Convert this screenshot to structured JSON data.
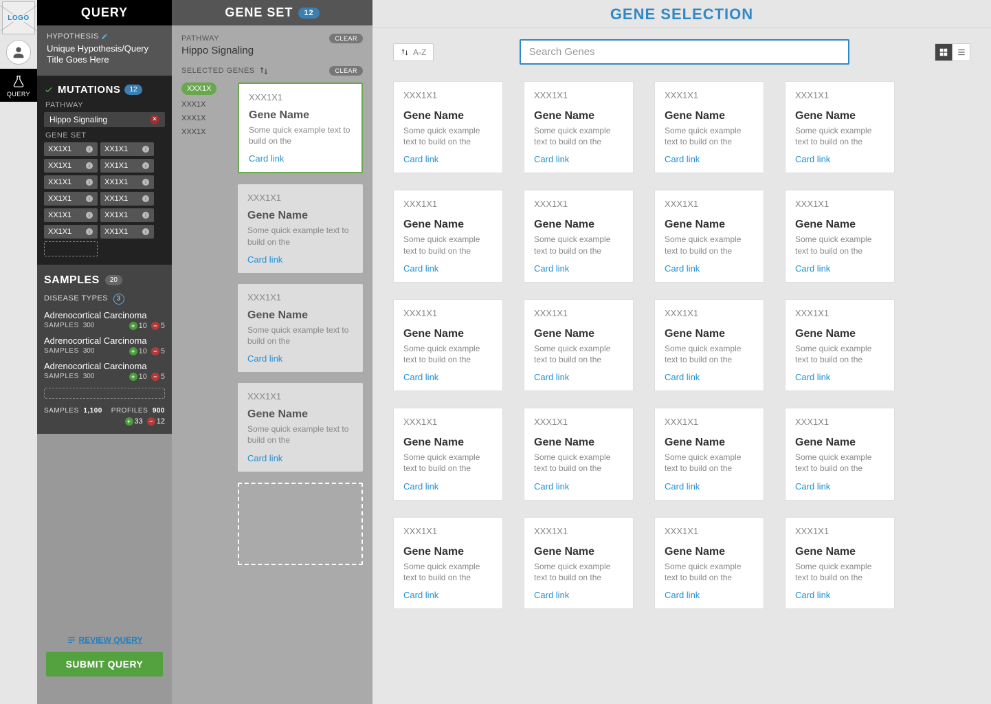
{
  "rail": {
    "logo": "LOGO",
    "query_label": "QUERY"
  },
  "query": {
    "title": "QUERY",
    "hypothesis_label": "HYPOTHESIS",
    "hypothesis_value": "Unique Hypothesis/Query Title Goes Here",
    "mutations": {
      "label": "MUTATIONS",
      "count": "12",
      "pathway_label": "PATHWAY",
      "pathway_value": "Hippo Signaling",
      "geneset_label": "GENE SET",
      "genes": [
        "XX1X1",
        "XX1X1",
        "XX1X1",
        "XX1X1",
        "XX1X1",
        "XX1X1",
        "XX1X1",
        "XX1X1",
        "XX1X1",
        "XX1X1",
        "XX1X1",
        "XX1X1"
      ]
    },
    "samples": {
      "label": "SAMPLES",
      "count": "20",
      "disease_types_label": "DISEASE TYPES",
      "disease_types_count": "3",
      "diseases": [
        {
          "name": "Adrenocortical Carcinoma",
          "samples_label": "SAMPLES",
          "samples": "300",
          "plus": "10",
          "minus": "5"
        },
        {
          "name": "Adrenocortical Carcinoma",
          "samples_label": "SAMPLES",
          "samples": "300",
          "plus": "10",
          "minus": "5"
        },
        {
          "name": "Adrenocortical Carcinoma",
          "samples_label": "SAMPLES",
          "samples": "300",
          "plus": "10",
          "minus": "5"
        }
      ],
      "totals": {
        "samples_label": "SAMPLES",
        "samples": "1,100",
        "profiles_label": "PROFILES",
        "profiles": "900",
        "plus": "33",
        "minus": "12"
      }
    },
    "review_label": "REVIEW QUERY",
    "submit_label": "SUBMIT QUERY"
  },
  "geneset": {
    "title": "GENE SET",
    "count": "12",
    "pathway_label": "PATHWAY",
    "pathway_value": "Hippo Signaling",
    "clear_label": "CLEAR",
    "selected_genes_label": "SELECTED GENES",
    "selected_list": [
      "XXX1X",
      "XXX1X",
      "XXX1X",
      "XXX1X"
    ],
    "cards": [
      {
        "code": "XXX1X1",
        "name": "Gene Name",
        "desc": "Some quick example text to build on the",
        "link": "Card link"
      },
      {
        "code": "XXX1X1",
        "name": "Gene Name",
        "desc": "Some quick example text to build on the",
        "link": "Card link"
      },
      {
        "code": "XXX1X1",
        "name": "Gene Name",
        "desc": "Some quick example text to build on the",
        "link": "Card link"
      },
      {
        "code": "XXX1X1",
        "name": "Gene Name",
        "desc": "Some quick example text to build on the",
        "link": "Card link"
      }
    ]
  },
  "selection": {
    "title": "GENE SELECTION",
    "sort_label": "A-Z",
    "search_placeholder": "Search Genes",
    "card": {
      "code": "XXX1X1",
      "name": "Gene Name",
      "desc": "Some quick example text to build on the",
      "link": "Card link"
    },
    "card_count": 20
  }
}
